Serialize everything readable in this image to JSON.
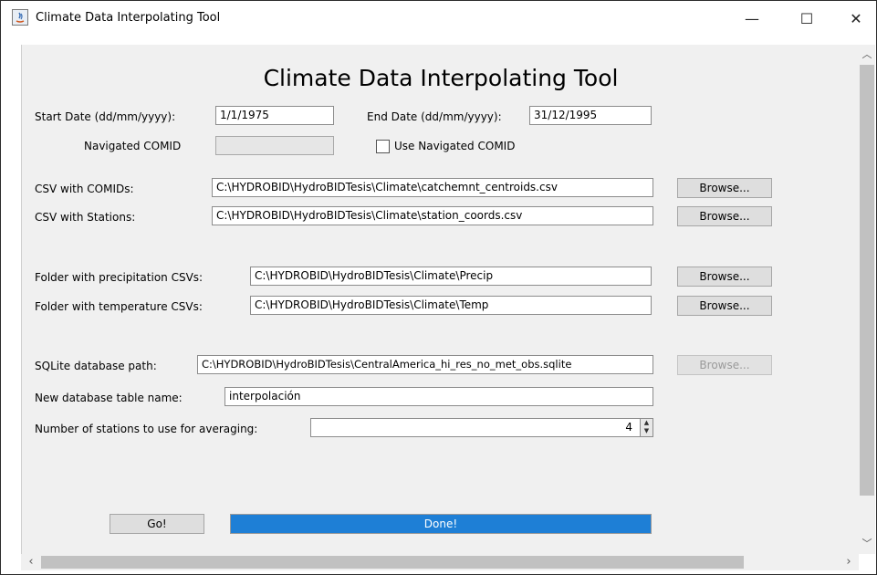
{
  "window": {
    "title": "Climate Data Interpolating Tool",
    "controls": {
      "minimize": "—",
      "maximize": "☐",
      "close": "✕"
    }
  },
  "form": {
    "heading": "Climate Data Interpolating Tool",
    "start_date": {
      "label": "Start Date (dd/mm/yyyy):",
      "value": "1/1/1975"
    },
    "end_date": {
      "label": "End Date (dd/mm/yyyy):",
      "value": "31/12/1995"
    },
    "navigated_comid": {
      "label": "Navigated COMID",
      "value": ""
    },
    "use_navigated_comid": {
      "label": "Use Navigated COMID",
      "checked": false
    },
    "csv_comids": {
      "label": "CSV with COMIDs:",
      "value": "C:\\HYDROBID\\HydroBIDTesis\\Climate\\catchemnt_centroids.csv",
      "button": "Browse..."
    },
    "csv_stations": {
      "label": "CSV with Stations:",
      "value": "C:\\HYDROBID\\HydroBIDTesis\\Climate\\station_coords.csv",
      "button": "Browse..."
    },
    "precip_folder": {
      "label": "Folder with precipitation CSVs:",
      "value": "C:\\HYDROBID\\HydroBIDTesis\\Climate\\Precip",
      "button": "Browse..."
    },
    "temp_folder": {
      "label": "Folder with temperature CSVs:",
      "value": "C:\\HYDROBID\\HydroBIDTesis\\Climate\\Temp",
      "button": "Browse..."
    },
    "sqlite_path": {
      "label": "SQLite database path:",
      "value": "C:\\HYDROBID\\HydroBIDTesis\\CentralAmerica_hi_res_no_met_obs.sqlite",
      "button": "Browse..."
    },
    "table_name": {
      "label": "New database table name:",
      "value": "interpolación"
    },
    "num_stations": {
      "label": "Number of stations to use for averaging:",
      "value": "4"
    },
    "go_button": "Go!",
    "progress": {
      "text": "Done!",
      "percent": 100
    }
  },
  "icons": {
    "scroll_up": "chevron-up-icon",
    "scroll_down": "chevron-down-icon",
    "scroll_left": "chevron-left-icon",
    "scroll_right": "chevron-right-icon"
  },
  "colors": {
    "progress_fill": "#1e7fd6",
    "panel_bg": "#f0f0f0"
  }
}
